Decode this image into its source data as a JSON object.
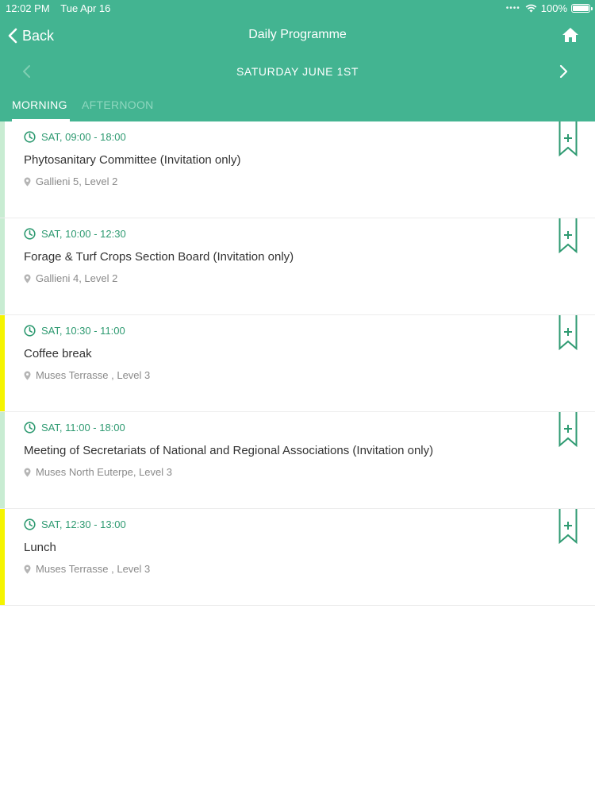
{
  "status": {
    "time": "12:02 PM",
    "date": "Tue Apr 16",
    "battery": "100%"
  },
  "nav": {
    "back_label": "Back",
    "title": "Daily Programme"
  },
  "date_nav": {
    "label": "SATURDAY JUNE 1ST"
  },
  "tabs": [
    {
      "label": "MORNING"
    },
    {
      "label": "AFTERNOON"
    }
  ],
  "colors": {
    "header": "#43b491",
    "accent": "#2e9a71",
    "session_bar": "#c8ecd2",
    "break_bar": "#f5f400"
  },
  "sessions": [
    {
      "time": "SAT, 09:00 - 18:00",
      "title": "Phytosanitary Committee (Invitation only)",
      "location": "Gallieni 5, Level 2",
      "bar": "#c8ecd2"
    },
    {
      "time": "SAT, 10:00 - 12:30",
      "title": "Forage & Turf  Crops Section Board (Invitation  only)",
      "location": "Gallieni 4, Level 2",
      "bar": "#c8ecd2"
    },
    {
      "time": "SAT, 10:30 - 11:00",
      "title": "Coffee break",
      "location": "Muses Terrasse , Level 3",
      "bar": "#f5f400"
    },
    {
      "time": "SAT, 11:00 - 18:00",
      "title": "Meeting of Secretariats of National and Regional Associations (Invitation only)",
      "location": "Muses North Euterpe, Level 3",
      "bar": "#c8ecd2"
    },
    {
      "time": "SAT, 12:30 - 13:00",
      "title": "Lunch",
      "location": "Muses Terrasse , Level 3",
      "bar": "#f5f400"
    }
  ]
}
